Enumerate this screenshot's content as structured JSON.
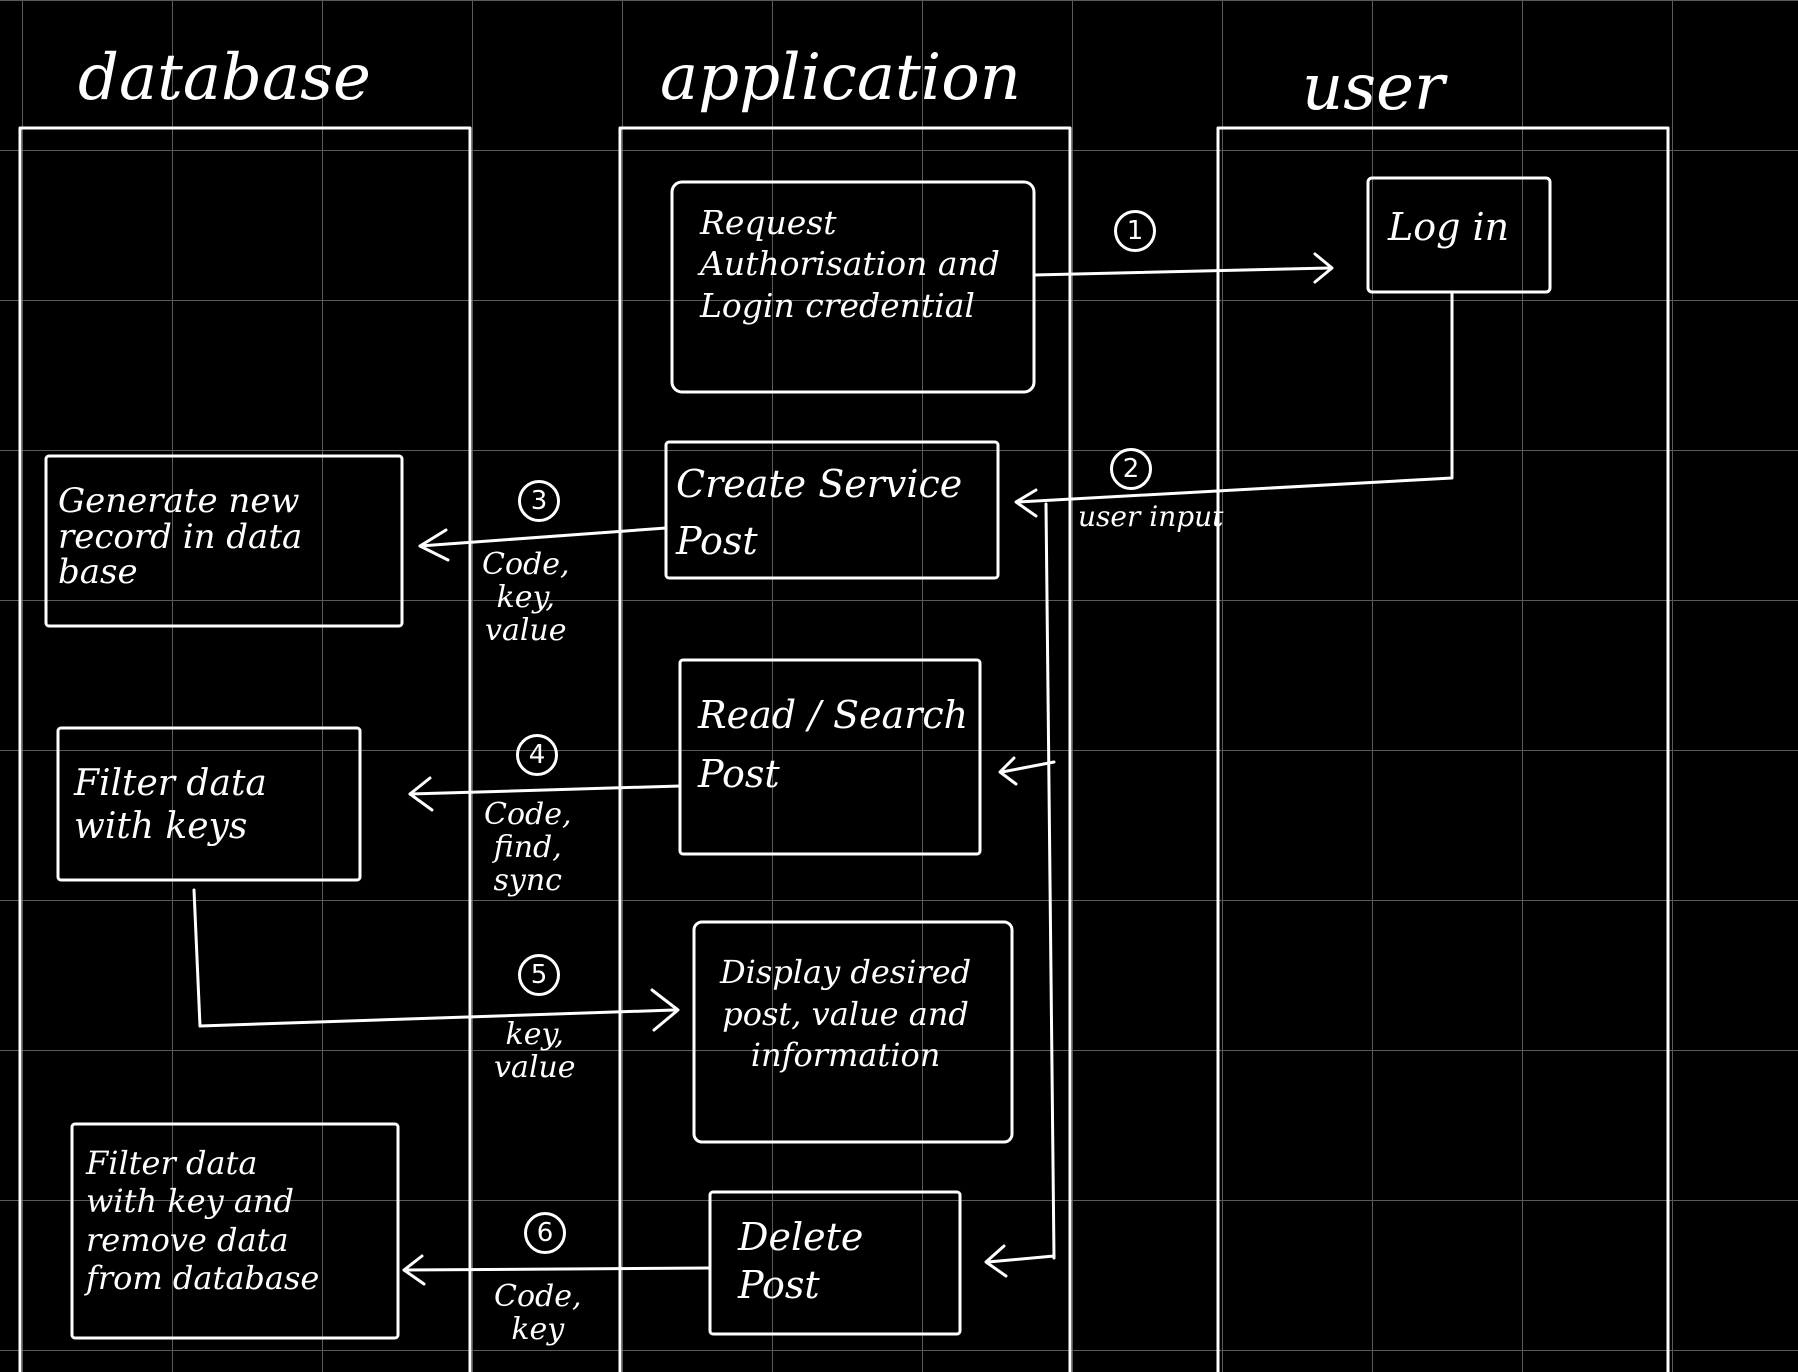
{
  "lanes": {
    "database": "database",
    "application": "application",
    "user": "user"
  },
  "boxes": {
    "request_auth": "Request\nAuthorisation and\nLogin credential",
    "log_in": "Log in",
    "create_service": "Create Service\nPost",
    "generate_record": "Generate new\nrecord in data\nbase",
    "read_search": "Read / Search\nPost",
    "filter_keys": "Filter data\nwith keys",
    "display_post": "Display desired\npost, value and\ninformation",
    "delete_post": "Delete\nPost",
    "filter_remove": "Filter data\nwith key and\nremove data\nfrom database"
  },
  "steps": {
    "s1": "1",
    "s2": "2",
    "s3": "3",
    "s4": "4",
    "s5": "5",
    "s6": "6"
  },
  "labels": {
    "user_input": "user input",
    "code_key_value": "Code,\nkey,\nvalue",
    "code_find_sync": "Code,\nfind,\nsync",
    "key_value": "key,\nvalue",
    "code_key": "Code,\nkey"
  },
  "colors": {
    "background": "#000000",
    "ink": "#ffffff",
    "grid": "#5a5a5a"
  }
}
